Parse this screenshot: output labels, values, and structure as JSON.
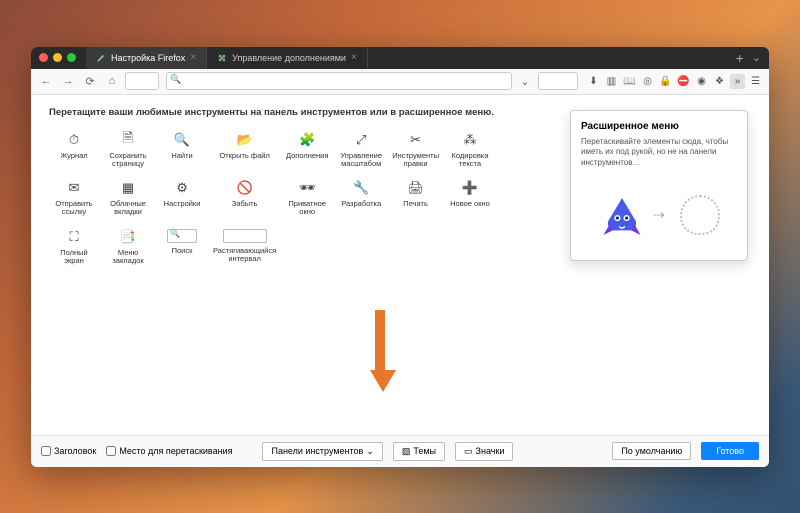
{
  "tabs": {
    "t1_label": "Настройка Firefox",
    "t2_label": "Управление дополнениями"
  },
  "instruction": "Перетащите ваши любимые инструменты на панель инструментов или в расширенное меню.",
  "tools": [
    {
      "icon": "⏱",
      "label": "Журнал"
    },
    {
      "icon": "🗎",
      "label": "Сохранить страницу"
    },
    {
      "icon": "🔍",
      "label": "Найти"
    },
    {
      "icon": "📂",
      "label": "Открыть файл"
    },
    {
      "icon": "🧩",
      "label": "Дополнения"
    },
    {
      "icon": "⤢",
      "label": "Управление масштабом"
    },
    {
      "icon": "✂",
      "label": "Инструменты правки"
    },
    {
      "icon": "⁂",
      "label": "Кодировка текста"
    },
    {
      "icon": "",
      "label": ""
    },
    {
      "icon": "✉",
      "label": "Отправить ссылку"
    },
    {
      "icon": "▦",
      "label": "Облачные вкладки"
    },
    {
      "icon": "⚙",
      "label": "Настройки"
    },
    {
      "icon": "🚫",
      "label": "Забыть"
    },
    {
      "icon": "🕶",
      "label": "Приватное окно"
    },
    {
      "icon": "🔧",
      "label": "Разработка"
    },
    {
      "icon": "🖨",
      "label": "Печать"
    },
    {
      "icon": "➕",
      "label": "Новое окно"
    },
    {
      "icon": "",
      "label": ""
    },
    {
      "icon": "⛶",
      "label": "Полный экран"
    },
    {
      "icon": "📑",
      "label": "Меню закладок"
    },
    {
      "icon": "__input",
      "label": "Поиск"
    },
    {
      "icon": "__spacer",
      "label": "Растягивающийся интервал"
    }
  ],
  "panel": {
    "title": "Расширенное меню",
    "text": "Перетаскивайте элементы сюда, чтобы иметь их под рукой, но не на панели инструментов…"
  },
  "footer": {
    "chk1": "Заголовок",
    "chk2": "Место для перетаскивания",
    "toolbars": "Панели инструментов",
    "themes": "Темы",
    "icons": "Значки",
    "defaults": "По умолчанию",
    "done": "Готово"
  }
}
